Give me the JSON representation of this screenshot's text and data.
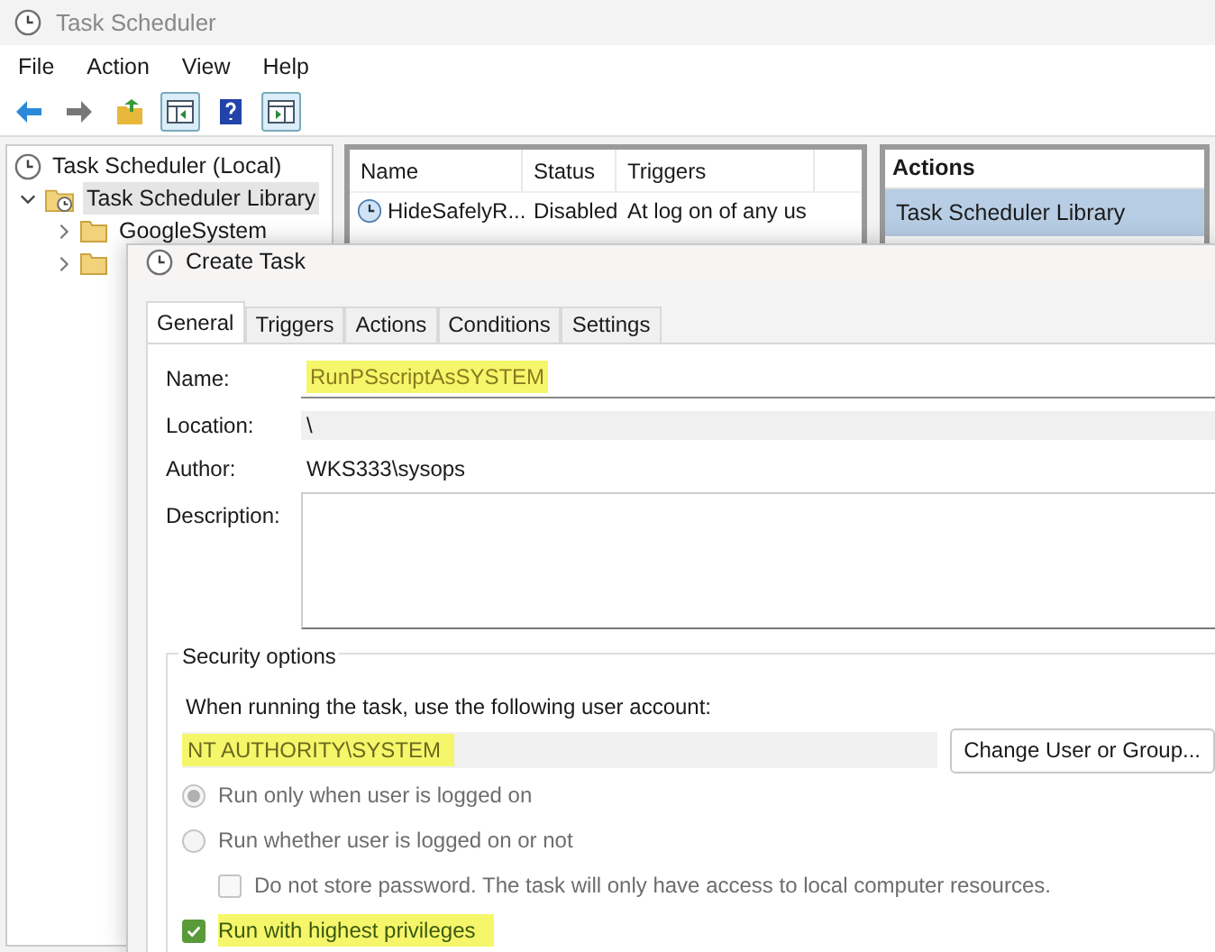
{
  "window": {
    "title": "Task Scheduler"
  },
  "menu": [
    "File",
    "Action",
    "View",
    "Help"
  ],
  "tree": [
    {
      "label": "Task Scheduler (Local)",
      "children": [
        {
          "label": "Task Scheduler Library",
          "selected": true,
          "expanded": true,
          "children": [
            {
              "label": "GoogleSystem",
              "expanded": false
            },
            {
              "expanded": false
            }
          ]
        }
      ]
    }
  ],
  "task_list": {
    "columns": [
      "Name",
      "Status",
      "Triggers"
    ],
    "rows": [
      [
        "HideSafelyR...",
        "Disabled",
        "At log on of any us"
      ]
    ]
  },
  "actions": {
    "title": "Actions",
    "items": [
      {
        "label": "Task Scheduler Library",
        "selected": true
      }
    ]
  },
  "dialog": {
    "title": "Create Task",
    "tabs": [
      {
        "label": "General",
        "selected": true
      },
      {
        "label": "Triggers",
        "selected": false
      },
      {
        "label": "Actions",
        "selected": false
      },
      {
        "label": "Conditions",
        "selected": false
      },
      {
        "label": "Settings",
        "selected": false
      }
    ],
    "name": {
      "label": "Name:",
      "value": "RunPSscriptAsSYSTEM",
      "highlighted": true
    },
    "location": {
      "label": "Location:",
      "value": "\\"
    },
    "author": {
      "label": "Author:",
      "value": "WKS333\\sysops"
    },
    "description": {
      "label": "Description:"
    },
    "security": {
      "title": "Security options",
      "prompt": "When running the task, use the following user account:",
      "account": "NT AUTHORITY\\SYSTEM",
      "account_highlighted": true,
      "change_button": "Change User or Group...",
      "options": [
        {
          "kind": "radio",
          "label": "Run only when user is logged on",
          "checked": true,
          "disabled": true,
          "indent": false,
          "highlighted": false
        },
        {
          "kind": "radio",
          "label": "Run whether user is logged on or not",
          "checked": false,
          "disabled": true,
          "indent": false,
          "highlighted": false
        },
        {
          "kind": "checkbox",
          "label": "Do not store password.  The task will only have access to local computer resources.",
          "checked": false,
          "disabled": true,
          "indent": true,
          "highlighted": false
        },
        {
          "kind": "checkbox",
          "label": "Run with highest privileges",
          "checked": true,
          "disabled": false,
          "indent": false,
          "highlighted": true
        }
      ]
    }
  }
}
